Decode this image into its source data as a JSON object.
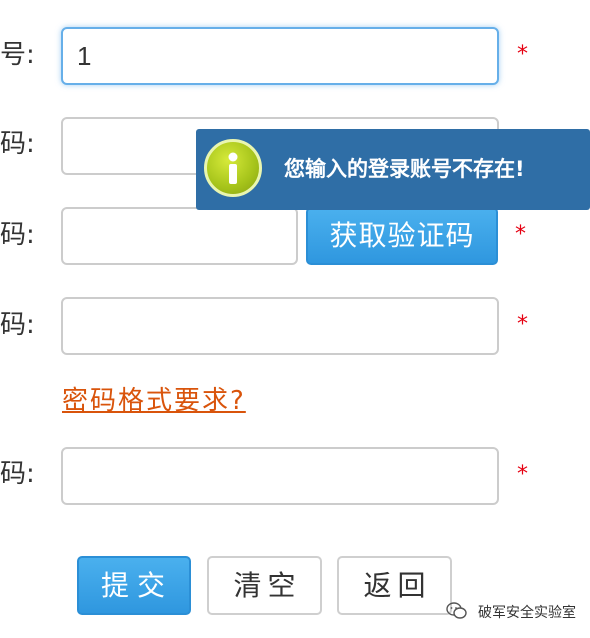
{
  "form": {
    "account_label_suffix": "号:",
    "account_value": "1",
    "password_label_suffix": "码:",
    "verify_label_suffix": "码:",
    "verify_value": "",
    "get_code_button": "获取验证码",
    "new_password_label_suffix": "码:",
    "password_rule_link": "密码格式要求?",
    "confirm_password_label_suffix": "码:",
    "required_mark": "*"
  },
  "tooltip": {
    "message": "您输入的登录账号不存在!",
    "icon": "info-icon"
  },
  "actions": {
    "submit": "提交",
    "clear": "清空",
    "back": "返回"
  },
  "watermark": {
    "text": "破军安全实验室",
    "icon": "wechat-icon"
  },
  "colors": {
    "primary": "#3aa0e6",
    "required": "#e60012",
    "link": "#d9540b",
    "tooltip_bg": "#2f6ea6"
  }
}
